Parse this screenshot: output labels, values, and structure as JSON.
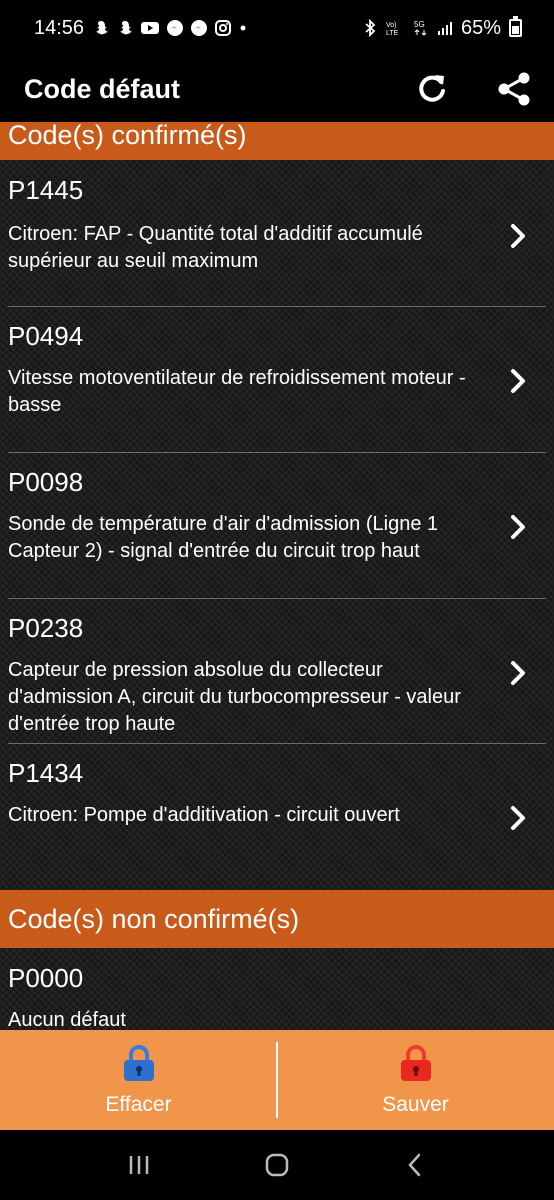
{
  "status": {
    "time": "14:56",
    "battery_text": "65%",
    "left_icons": [
      "snapchat-icon",
      "snapchat-icon",
      "youtube-icon",
      "messenger-icon",
      "messenger-icon",
      "instagram-icon",
      "dot-icon"
    ],
    "right_icons": [
      "bluetooth-icon",
      "volte-icon",
      "5g-icon",
      "signal-icon"
    ]
  },
  "app_bar": {
    "title": "Code défaut",
    "actions": [
      "refresh-icon",
      "share-icon"
    ]
  },
  "sections": {
    "confirmed_title": "Code(s) confirmé(s)",
    "unconfirmed_title": "Code(s) non confirmé(s)"
  },
  "confirmed_codes": [
    {
      "code": "P1445",
      "description": "Citroen: FAP - Quantité total d'additif accumulé supérieur au seuil maximum"
    },
    {
      "code": "P0494",
      "description": "Vitesse motoventilateur de refroidissement moteur - basse"
    },
    {
      "code": "P0098",
      "description": "Sonde de température d'air d'admission (Ligne 1 Capteur 2) - signal d'entrée du circuit trop haut"
    },
    {
      "code": "P0238",
      "description": "Capteur de pression absolue du collecteur d'admission A, circuit du turbocompresseur - valeur d'entrée trop haute"
    },
    {
      "code": "P1434",
      "description": "Citroen: Pompe d'additivation - circuit ouvert"
    }
  ],
  "unconfirmed_codes": [
    {
      "code": "P0000",
      "description": "Aucun défaut"
    }
  ],
  "bottom_bar": {
    "clear_label": "Effacer",
    "save_label": "Sauver",
    "colors": {
      "bar": "#f0954a",
      "clear_lock": "#2f6fd0",
      "save_lock": "#e8281e"
    }
  },
  "colors": {
    "section_header": "#c85a1a"
  }
}
